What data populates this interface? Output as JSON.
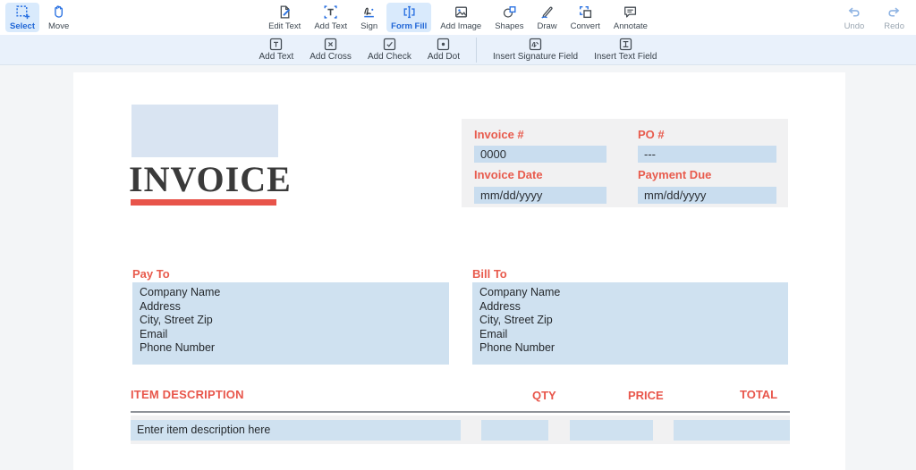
{
  "toolbar": {
    "left": [
      {
        "label": "Select",
        "active": true
      },
      {
        "label": "Move"
      }
    ],
    "center": [
      {
        "label": "Edit Text"
      },
      {
        "label": "Add Text"
      },
      {
        "label": "Sign"
      },
      {
        "label": "Form Fill",
        "active": true
      },
      {
        "label": "Add Image"
      },
      {
        "label": "Shapes"
      },
      {
        "label": "Draw"
      },
      {
        "label": "Convert"
      },
      {
        "label": "Annotate"
      }
    ],
    "right": [
      {
        "label": "Undo"
      },
      {
        "label": "Redo"
      }
    ]
  },
  "subtoolbar": {
    "items": [
      {
        "label": "Add Text"
      },
      {
        "label": "Add Cross"
      },
      {
        "label": "Add Check"
      },
      {
        "label": "Add Dot"
      },
      {
        "label": "Insert Signature Field"
      },
      {
        "label": "Insert Text Field"
      }
    ]
  },
  "invoice": {
    "title": "INVOICE",
    "meta": {
      "invoice_no_label": "Invoice #",
      "invoice_no": "0000",
      "po_label": "PO #",
      "po": "---",
      "date_label": "Invoice Date",
      "date": "mm/dd/yyyy",
      "due_label": "Payment Due",
      "due": "mm/dd/yyyy"
    },
    "pay_to": {
      "label": "Pay To",
      "lines": [
        "Company Name",
        "Address",
        "City, Street Zip",
        "Email",
        "Phone Number"
      ]
    },
    "bill_to": {
      "label": "Bill To",
      "lines": [
        "Company Name",
        "Address",
        "City, Street Zip",
        "Email",
        "Phone Number"
      ]
    },
    "items_table": {
      "headers": [
        "ITEM DESCRIPTION",
        "QTY",
        "PRICE",
        "TOTAL"
      ],
      "row_placeholder": "Enter item description here"
    }
  },
  "colors": {
    "accent_blue": "#2066d6",
    "active_button_bg": "#d9eafc",
    "subbar_blue": "#e9f1fb",
    "label_red": "#e85b4d",
    "field_blue": "#cfe1f0",
    "panel_gray": "#f1f1f2",
    "red_bar": "#e8544a"
  }
}
